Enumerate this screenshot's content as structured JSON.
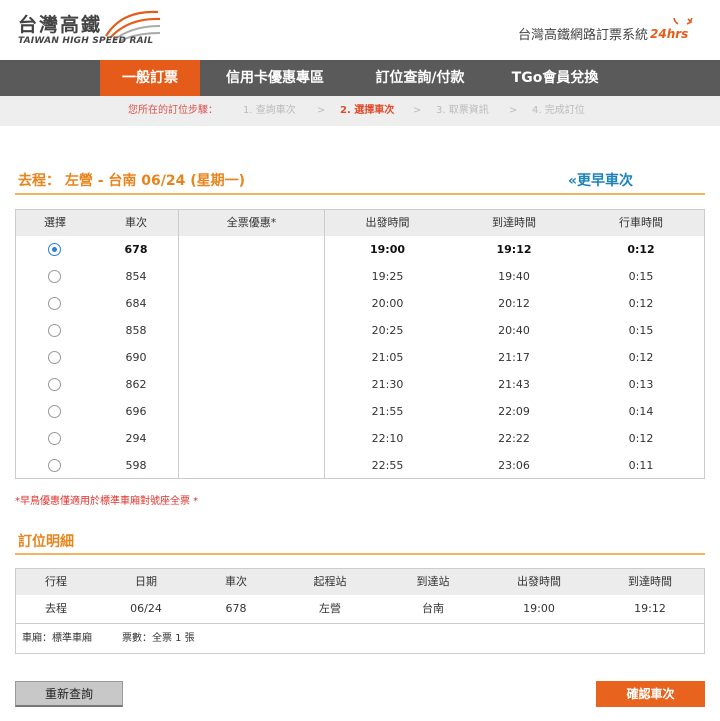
{
  "header": {
    "logo_cn": "台灣高鐵",
    "logo_en": "TAIWAN HIGH SPEED RAIL",
    "system_title": "台灣高鐵網路訂票系統",
    "badge_24": "24hrs",
    "brand_color": "#e55c1a"
  },
  "nav": {
    "items": [
      {
        "label": "一般訂票",
        "active": true
      },
      {
        "label": "信用卡優惠專區",
        "active": false
      },
      {
        "label": "訂位查詢/付款",
        "active": false
      },
      {
        "label": "TGo會員兌換",
        "active": false
      }
    ]
  },
  "steps": {
    "label": "您所在的訂位步驟：",
    "items": [
      "1. 查詢車次",
      "2. 選擇車次",
      "3. 取票資訊",
      "4. 完成訂位"
    ],
    "sep": ">",
    "current_index": 1
  },
  "trip": {
    "title": "去程： 左營 - 台南 06/24 (星期一)",
    "earlier_link": "«更早車次"
  },
  "train_table": {
    "headers": [
      "選擇",
      "車次",
      "全票優惠*",
      "出發時間",
      "到達時間",
      "行車時間"
    ],
    "rows": [
      {
        "selected": true,
        "train": "678",
        "discount": "",
        "depart": "19:00",
        "arrive": "19:12",
        "duration": "0:12"
      },
      {
        "selected": false,
        "train": "854",
        "discount": "",
        "depart": "19:25",
        "arrive": "19:40",
        "duration": "0:15"
      },
      {
        "selected": false,
        "train": "684",
        "discount": "",
        "depart": "20:00",
        "arrive": "20:12",
        "duration": "0:12"
      },
      {
        "selected": false,
        "train": "858",
        "discount": "",
        "depart": "20:25",
        "arrive": "20:40",
        "duration": "0:15"
      },
      {
        "selected": false,
        "train": "690",
        "discount": "",
        "depart": "21:05",
        "arrive": "21:17",
        "duration": "0:12"
      },
      {
        "selected": false,
        "train": "862",
        "discount": "",
        "depart": "21:30",
        "arrive": "21:43",
        "duration": "0:13"
      },
      {
        "selected": false,
        "train": "696",
        "discount": "",
        "depart": "21:55",
        "arrive": "22:09",
        "duration": "0:14"
      },
      {
        "selected": false,
        "train": "294",
        "discount": "",
        "depart": "22:10",
        "arrive": "22:22",
        "duration": "0:12"
      },
      {
        "selected": false,
        "train": "598",
        "discount": "",
        "depart": "22:55",
        "arrive": "23:06",
        "duration": "0:11"
      }
    ]
  },
  "note": "*早鳥優惠僅適用於標準車廂對號座全票 *",
  "detail": {
    "title": "訂位明細",
    "headers": [
      "行程",
      "日期",
      "車次",
      "起程站",
      "到達站",
      "出發時間",
      "到達時間"
    ],
    "row": [
      "去程",
      "06/24",
      "678",
      "左營",
      "台南",
      "19:00",
      "19:12"
    ],
    "car_type": "車廂：標準車廂",
    "ticket_count": "票數：全票 1 張"
  },
  "buttons": {
    "requery": "重新查詢",
    "confirm": "確認車次"
  }
}
